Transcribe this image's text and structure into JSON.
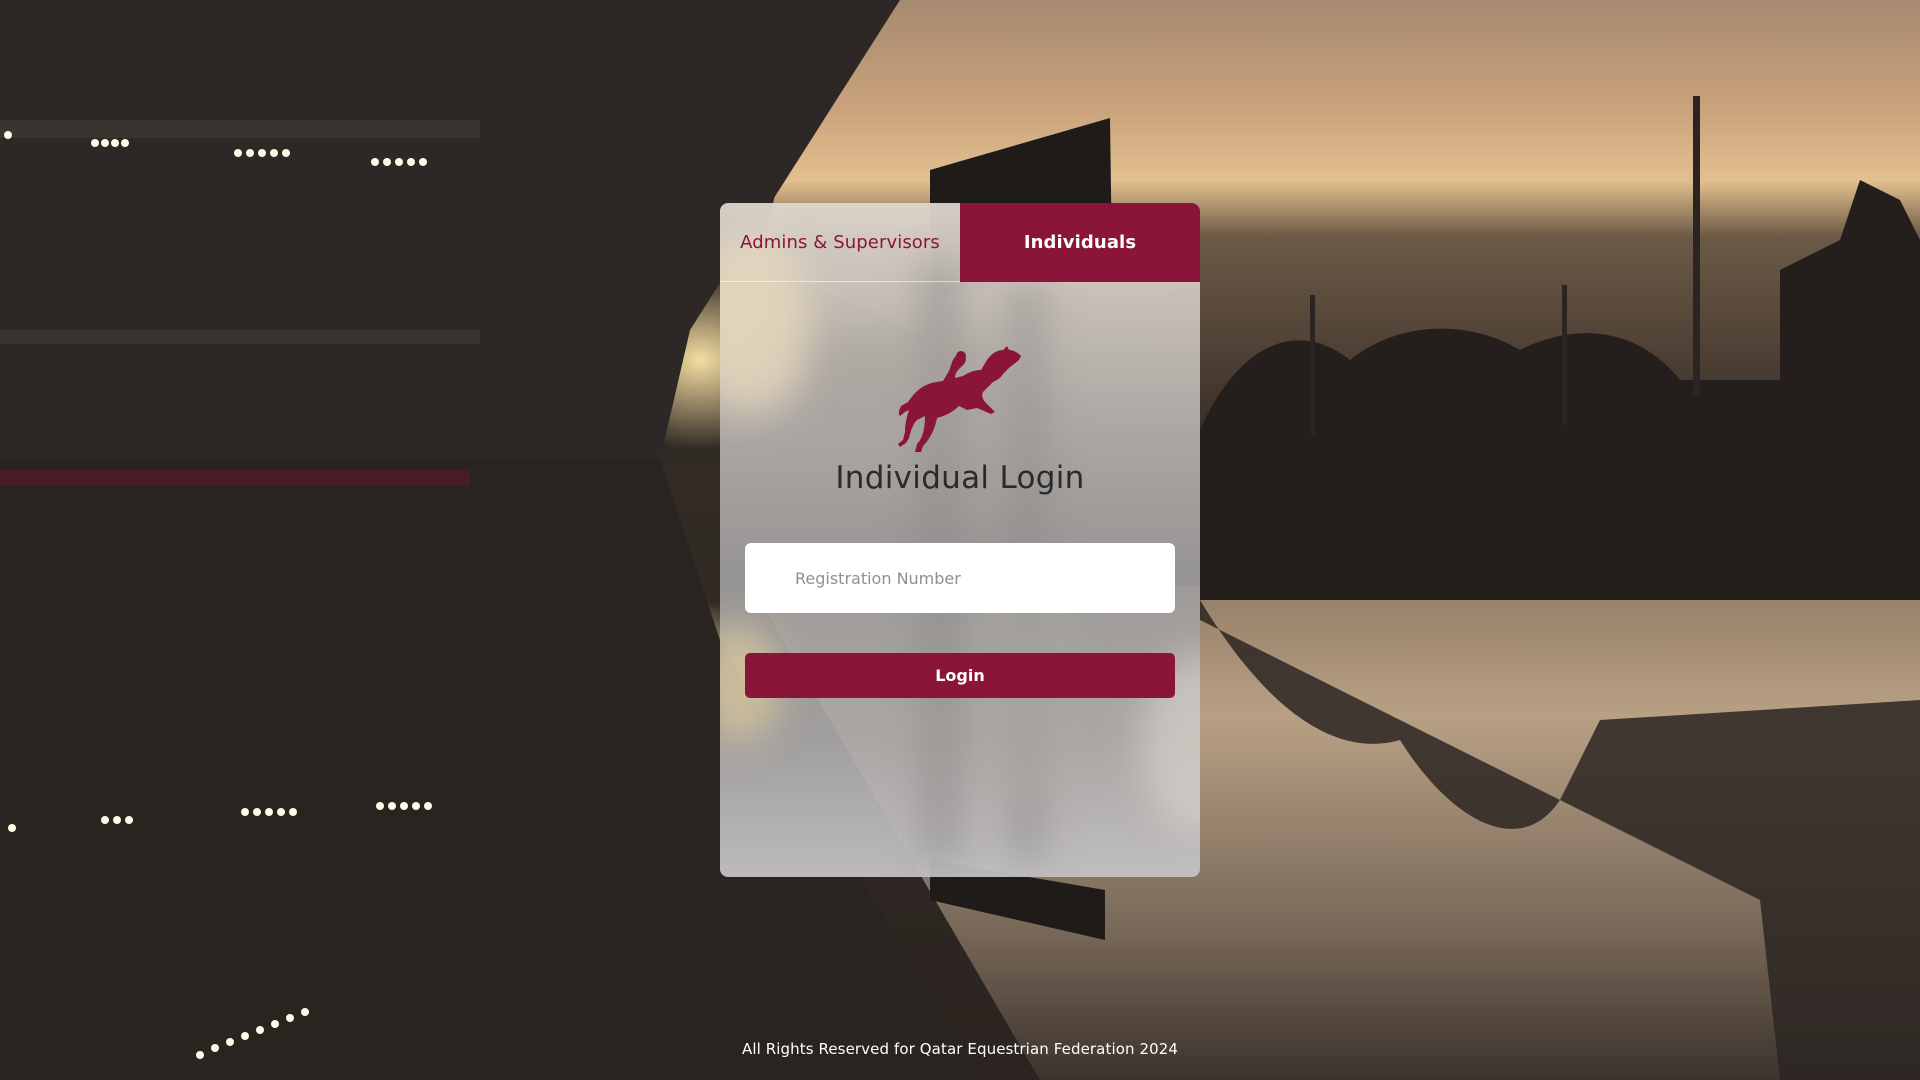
{
  "tabs": {
    "admins_label": "Admins & Supervisors",
    "individuals_label": "Individuals",
    "active": "Individuals"
  },
  "login": {
    "title": "Individual Login",
    "registration_placeholder": "Registration Number",
    "registration_value": "",
    "button_label": "Login"
  },
  "footer": {
    "copyright": "All Rights Reserved for Qatar Equestrian Federation 2024"
  },
  "icons": {
    "logo": "show-jumping-horse-icon"
  },
  "colors": {
    "brand": "#8a1538",
    "panel": "#a9a7a8",
    "footer_text": "#ffffff"
  }
}
